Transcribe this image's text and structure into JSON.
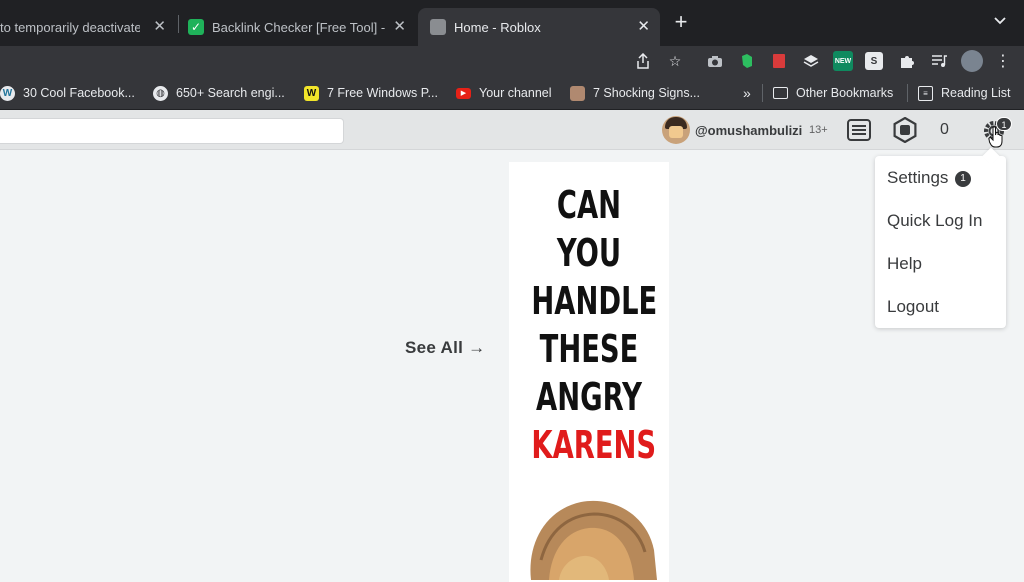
{
  "browser": {
    "tabs": [
      {
        "title": "to temporarily deactivate",
        "active": false
      },
      {
        "title": "Backlink Checker [Free Tool] -",
        "active": false
      },
      {
        "title": "Home - Roblox",
        "active": true
      }
    ],
    "bookmarks": [
      {
        "label": "30 Cool Facebook...",
        "icon": "wordpress-icon"
      },
      {
        "label": "650+ Search engi...",
        "icon": "globe-icon"
      },
      {
        "label": "7 Free Windows P...",
        "icon": "w-icon"
      },
      {
        "label": "Your channel",
        "icon": "youtube-icon"
      },
      {
        "label": "7 Shocking Signs...",
        "icon": "photo-icon"
      }
    ],
    "bookmarks_overflow": "»",
    "other_bookmarks": "Other Bookmarks",
    "reading_list": "Reading List",
    "new_ext_label": "NEW",
    "s_ext_label": "S"
  },
  "header": {
    "username": "@omushambulizi",
    "age_badge": "13+",
    "robux": "0",
    "notification_count": "1"
  },
  "content": {
    "see_all": "See All →",
    "ad_lines": [
      "CAN",
      "YOU",
      "HANDLE",
      "THESE",
      "ANGRY"
    ],
    "ad_highlight": "KARENS"
  },
  "menu": {
    "items": [
      "Settings",
      "Quick Log In",
      "Help",
      "Logout"
    ],
    "settings_badge": "1"
  },
  "colors": {
    "browser_dark": "#202124",
    "toolbar": "#35363a",
    "roblox_header": "#e3e5e6",
    "page_bg": "#f2f4f5",
    "ad_red": "#e01b1b"
  }
}
